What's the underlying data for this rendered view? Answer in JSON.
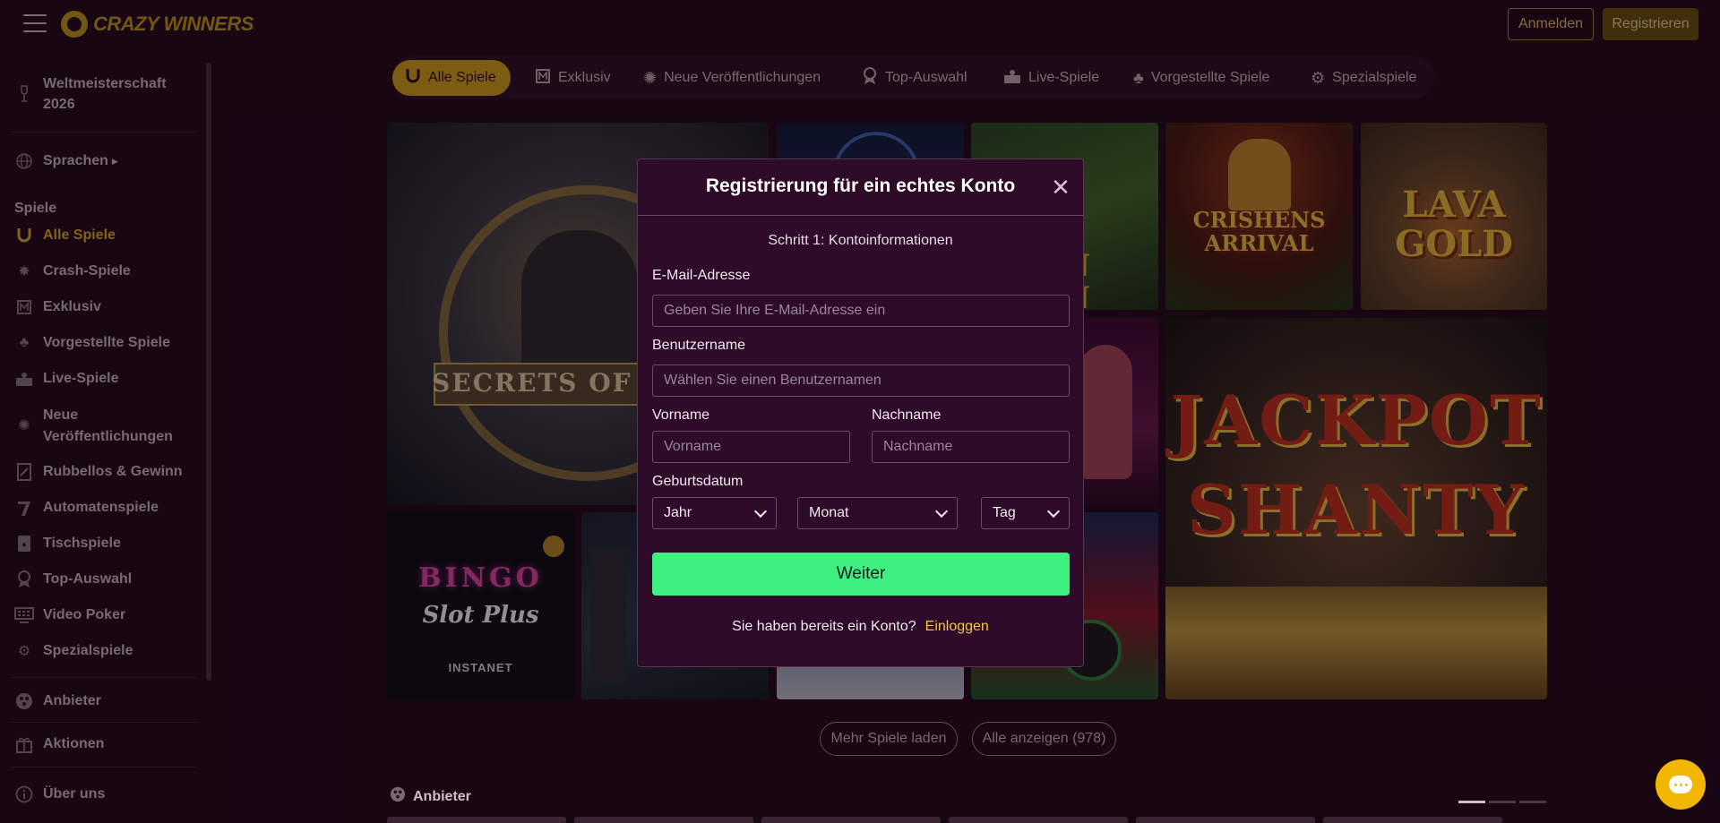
{
  "header": {
    "logo_text": "CRAZY WINNERS",
    "login_label": "Anmelden",
    "register_label": "Registrieren"
  },
  "sidebar": {
    "promo": {
      "line1": "Weltmeisterschaft",
      "line2": "2026"
    },
    "languages_label": "Sprachen",
    "games_heading": "Spiele",
    "items": [
      {
        "label": "Alle Spiele",
        "icon": "horseshoe-icon",
        "active": true
      },
      {
        "label": "Crash-Spiele",
        "icon": "explosion-icon"
      },
      {
        "label": "Exklusiv",
        "icon": "exclusive-icon"
      },
      {
        "label": "Vorgestellte Spiele",
        "icon": "clover-icon"
      },
      {
        "label": "Live-Spiele",
        "icon": "live-dealer-icon"
      },
      {
        "label": "Neue Veröffentlichungen",
        "line1": "Neue",
        "line2": "Veröffentlichungen",
        "icon": "new-release-icon"
      },
      {
        "label": "Rubbellos & Gewinn",
        "icon": "scratch-card-icon"
      },
      {
        "label": "Automatenspiele",
        "icon": "slot-machine-icon"
      },
      {
        "label": "Tischspiele",
        "icon": "table-games-icon"
      },
      {
        "label": "Top-Auswahl",
        "icon": "award-icon"
      },
      {
        "label": "Video Poker",
        "icon": "video-poker-icon"
      },
      {
        "label": "Spezialspiele",
        "icon": "gear-icon"
      }
    ],
    "providers_label": "Anbieter",
    "promotions_label": "Aktionen",
    "about_label": "Über uns"
  },
  "categories": [
    {
      "label": "Alle Spiele",
      "icon": "horseshoe-icon",
      "active": true
    },
    {
      "label": "Exklusiv",
      "icon": "exclusive-icon"
    },
    {
      "label": "Neue Veröffentlichungen",
      "icon": "new-release-icon"
    },
    {
      "label": "Top-Auswahl",
      "icon": "award-icon"
    },
    {
      "label": "Live-Spiele",
      "icon": "live-dealer-icon"
    },
    {
      "label": "Vorgestellte Spiele",
      "icon": "clover-icon"
    },
    {
      "label": "Spezialspiele",
      "icon": "gear-icon"
    }
  ],
  "games": {
    "secrets": "SECRETS OF TH",
    "crishens": "CRISHENS ARRIVAL",
    "lava": "LAVA GOLD",
    "jackpot_line1": "JACKPOT",
    "jackpot_line2": "SHANTY",
    "bingo": "BINGO",
    "bingo_sub": "Slot Plus",
    "bingo_provider": "INSTANET",
    "golden_line1": "EN",
    "golden_line2": "EN"
  },
  "load_more_label": "Mehr Spiele laden",
  "show_all_label": "Alle anzeigen (978)",
  "providers_heading": "Anbieter",
  "modal": {
    "title": "Registrierung für ein echtes Konto",
    "step": "Schritt 1: Kontoinformationen",
    "email_label": "E-Mail-Adresse",
    "email_placeholder": "Geben Sie Ihre E-Mail-Adresse ein",
    "username_label": "Benutzername",
    "username_placeholder": "Wählen Sie einen Benutzernamen",
    "firstname_label": "Vorname",
    "firstname_placeholder": "Vorname",
    "lastname_label": "Nachname",
    "lastname_placeholder": "Nachname",
    "dob_label": "Geburtsdatum",
    "year_label": "Jahr",
    "month_label": "Monat",
    "day_label": "Tag",
    "next_label": "Weiter",
    "have_account": "Sie haben bereits ein Konto?",
    "login_link": "Einloggen"
  },
  "colors": {
    "background": "#250a1d",
    "accent_gold": "#d9a71c",
    "primary_green": "#3df07f",
    "link_yellow": "#f4c542",
    "chat_yellow": "#f2b600"
  }
}
